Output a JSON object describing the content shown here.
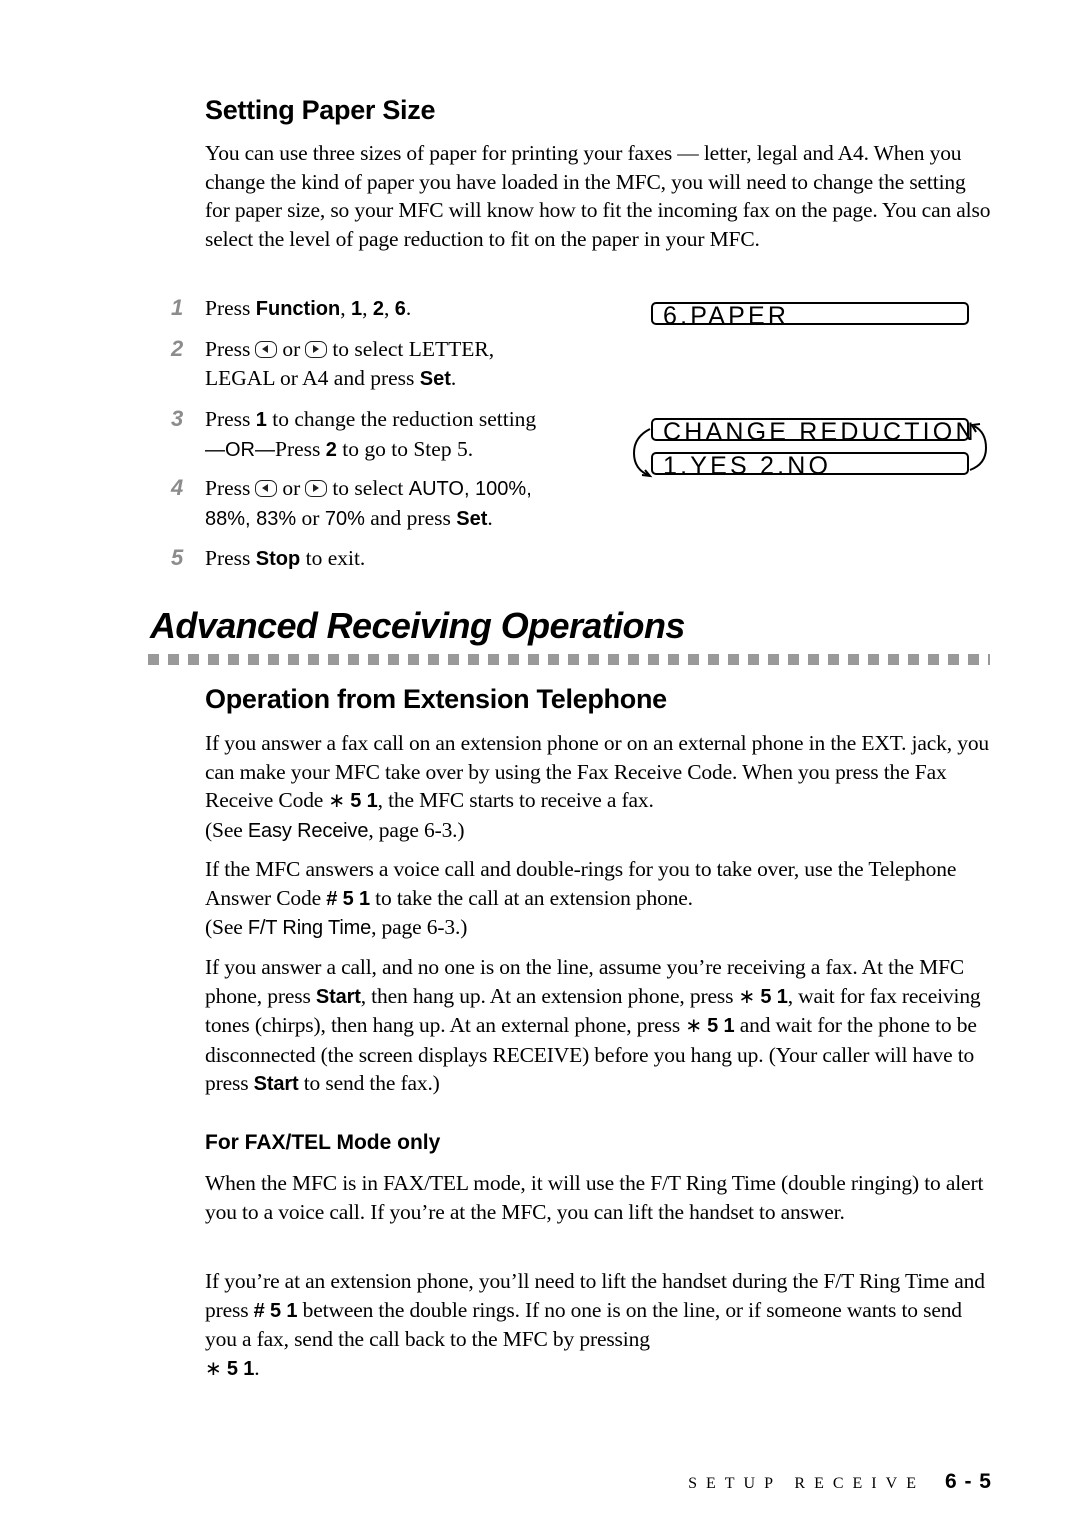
{
  "section1": {
    "heading": "Setting Paper Size",
    "intro": "You can use three sizes of paper for printing your faxes — letter, legal and A4. When you change the kind of paper you have loaded in the MFC, you will need to change the setting for paper size, so your MFC will know how to fit the incoming fax on the page.  You can also select the level of page reduction to fit on the paper in your MFC.",
    "steps": [
      {
        "num": "1",
        "t1": "Press ",
        "b1": "Function",
        "t2": ", ",
        "b2": "1",
        "t3": ", ",
        "b3": "2",
        "t4": ", ",
        "b4": "6",
        "t5": "."
      },
      {
        "num": "2",
        "t1": "Press",
        "or": "or",
        "t2": "to select LETTER,",
        "t3": "LEGAL or A4 and press ",
        "b1": "Set",
        "t4": "."
      },
      {
        "num": "3",
        "t1": "Press ",
        "b1": "1",
        "t2": " to change the reduction setting",
        "or": "—OR—",
        "t3": "Press ",
        "b2": "2",
        "t4": " to go to Step 5."
      },
      {
        "num": "4",
        "t1": "Press",
        "or": "or",
        "t2": "to select ",
        "opts1": "AUTO, 100%,",
        "opts2": "88%, 83%",
        "t3": " or ",
        "opts3": "70%",
        "t4": " and press ",
        "b1": "Set",
        "t5": "."
      },
      {
        "num": "5",
        "t1": "Press ",
        "b1": "Stop",
        "t2": " to exit."
      }
    ],
    "lcd": {
      "screen1": "6.PAPER",
      "screen2_line1": "CHANGE REDUCTION",
      "screen2_line2": "1.YES 2.NO"
    }
  },
  "section2": {
    "title": "Advanced Receiving Operations",
    "subheading": "Operation from Extension Telephone",
    "p1": {
      "a": "If you answer a fax call on an extension phone or on an external phone in the EXT. jack, you can make your MFC take over by using the Fax Receive Code. When you press the Fax Receive Code ",
      "code": "5 1",
      "b": ", the MFC starts to receive a fax.",
      "see": "(See ",
      "link": "Easy Receive",
      "c": ", page 6-3.)"
    },
    "p2": {
      "a": "If the MFC answers a voice call and double-rings for you to take over, use the Telephone Answer Code ",
      "code": "# 5 1",
      "b": " to take the call at an extension phone.",
      "see": "(See ",
      "link": "F/T Ring Time",
      "c": ", page 6-3.)"
    },
    "p3": {
      "a": "If you answer a call, and no one is on the line, assume you’re receiving a fax. At the MFC phone, press ",
      "start": "Start",
      "b": ", then hang up. At an extension phone, press ",
      "code": "5 1",
      "c": ", wait for fax receiving tones (chirps), then hang up.  At an external phone, press ",
      "d": " and wait for the phone to be disconnected (the screen displays RECEIVE) before you hang up. (Your caller will have to press ",
      "e": " to send the fax.)"
    },
    "subsub": "For FAX/TEL Mode only",
    "p4": "When the MFC is in FAX/TEL mode, it will use the F/T Ring Time (double ringing) to alert you to a voice call. If you’re at the MFC, you can lift the handset to answer.",
    "p5": {
      "a": "If you’re at an extension phone, you’ll need to lift the handset during the F/T Ring Time and press ",
      "code": "# 5 1",
      "b": " between the double rings. If no one is on the line, or if someone wants to send you a fax, send the call back to the MFC by pressing ",
      "code2": "5 1",
      "c": "."
    }
  },
  "footer": {
    "chapter": "SETUP RECEIVE",
    "page": "6 - 5"
  }
}
